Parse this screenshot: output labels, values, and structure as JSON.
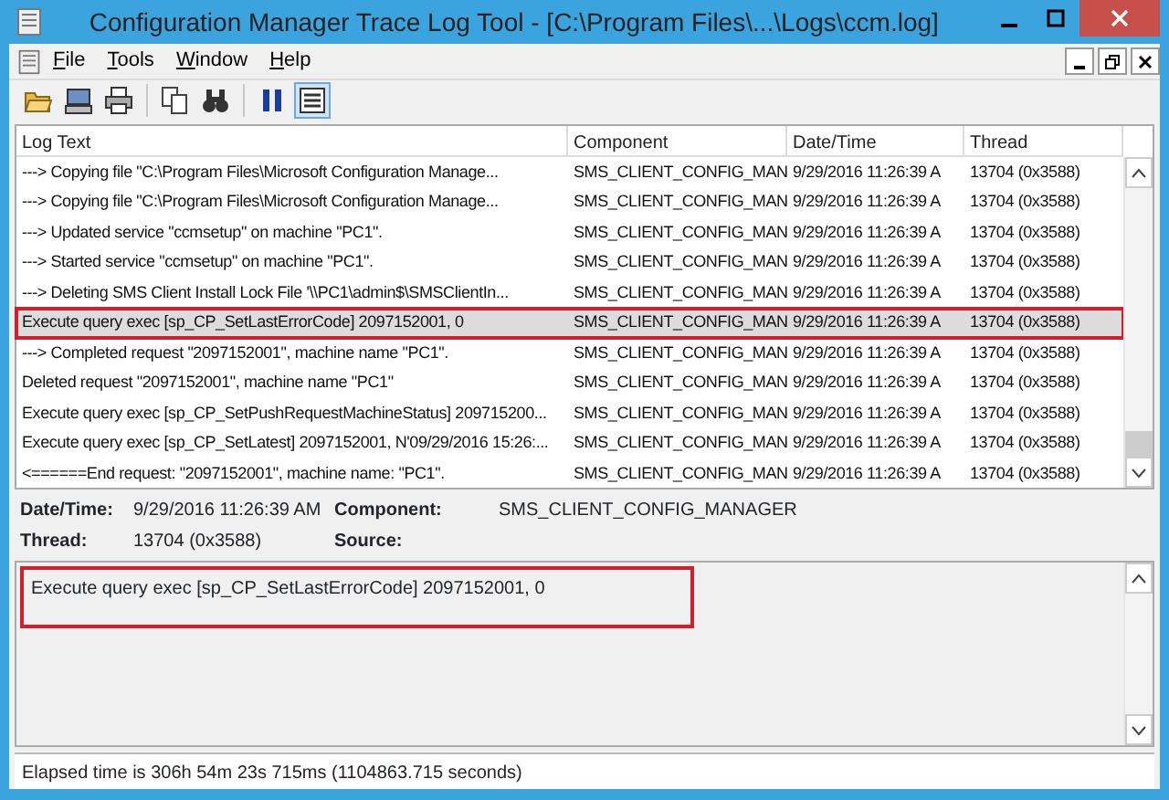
{
  "window": {
    "title": "Configuration Manager Trace Log Tool - [C:\\Program Files\\...\\Logs\\ccm.log]"
  },
  "menu": [
    "File",
    "Tools",
    "Window",
    "Help"
  ],
  "toolbar": [
    {
      "kind": "open"
    },
    {
      "kind": "computer"
    },
    {
      "kind": "print"
    },
    {
      "kind": "separator"
    },
    {
      "kind": "copy"
    },
    {
      "kind": "find"
    },
    {
      "kind": "separator"
    },
    {
      "kind": "pause",
      "selected": false
    },
    {
      "kind": "highlight",
      "selected": true
    }
  ],
  "table": {
    "columns": [
      "Log Text",
      "Component",
      "Date/Time",
      "Thread"
    ],
    "rows": [
      {
        "cells": [
          "---> Copying file \"C:\\Program Files\\Microsoft Configuration Manage...",
          "SMS_CLIENT_CONFIG_MAN",
          "9/29/2016 11:26:39 A",
          "13704 (0x3588)"
        ],
        "selected": false,
        "annotated": false
      },
      {
        "cells": [
          "---> Copying file \"C:\\Program Files\\Microsoft Configuration Manage...",
          "SMS_CLIENT_CONFIG_MAN",
          "9/29/2016 11:26:39 A",
          "13704 (0x3588)"
        ],
        "selected": false,
        "annotated": false
      },
      {
        "cells": [
          "---> Updated service \"ccmsetup\" on machine \"PC1\".",
          "SMS_CLIENT_CONFIG_MAN",
          "9/29/2016 11:26:39 A",
          "13704 (0x3588)"
        ],
        "selected": false,
        "annotated": false
      },
      {
        "cells": [
          "---> Started service \"ccmsetup\" on machine \"PC1\".",
          "SMS_CLIENT_CONFIG_MAN",
          "9/29/2016 11:26:39 A",
          "13704 (0x3588)"
        ],
        "selected": false,
        "annotated": false
      },
      {
        "cells": [
          "---> Deleting SMS Client Install Lock File '\\\\PC1\\admin$\\SMSClientIn...",
          "SMS_CLIENT_CONFIG_MAN",
          "9/29/2016 11:26:39 A",
          "13704 (0x3588)"
        ],
        "selected": false,
        "annotated": false
      },
      {
        "cells": [
          "Execute query exec [sp_CP_SetLastErrorCode] 2097152001, 0",
          "SMS_CLIENT_CONFIG_MAN",
          "9/29/2016 11:26:39 A",
          "13704 (0x3588)"
        ],
        "selected": true,
        "annotated": true
      },
      {
        "cells": [
          "---> Completed request \"2097152001\", machine name \"PC1\".",
          "SMS_CLIENT_CONFIG_MAN",
          "9/29/2016 11:26:39 A",
          "13704 (0x3588)"
        ],
        "selected": false,
        "annotated": false
      },
      {
        "cells": [
          "Deleted request \"2097152001\", machine name \"PC1\"",
          "SMS_CLIENT_CONFIG_MAN",
          "9/29/2016 11:26:39 A",
          "13704 (0x3588)"
        ],
        "selected": false,
        "annotated": false
      },
      {
        "cells": [
          "Execute query exec [sp_CP_SetPushRequestMachineStatus] 209715200...",
          "SMS_CLIENT_CONFIG_MAN",
          "9/29/2016 11:26:39 A",
          "13704 (0x3588)"
        ],
        "selected": false,
        "annotated": false
      },
      {
        "cells": [
          "Execute query exec [sp_CP_SetLatest] 2097152001, N'09/29/2016 15:26:...",
          "SMS_CLIENT_CONFIG_MAN",
          "9/29/2016 11:26:39 A",
          "13704 (0x3588)"
        ],
        "selected": false,
        "annotated": false
      },
      {
        "cells": [
          "<======End request: \"2097152001\", machine name: \"PC1\".",
          "SMS_CLIENT_CONFIG_MAN",
          "9/29/2016 11:26:39 A",
          "13704 (0x3588)"
        ],
        "selected": false,
        "annotated": false
      }
    ]
  },
  "details": {
    "datetime_label": "Date/Time:",
    "datetime": "9/29/2016 11:26:39 AM",
    "component_label": "Component:",
    "component": "SMS_CLIENT_CONFIG_MANAGER",
    "thread_label": "Thread:",
    "thread": "13704 (0x3588)",
    "source_label": "Source:"
  },
  "message": {
    "text": "Execute query exec [sp_CP_SetLastErrorCode] 2097152001, 0",
    "annotated": true
  },
  "status_bar": "Elapsed time is 306h 54m 23s 715ms (1104863.715 seconds)"
}
